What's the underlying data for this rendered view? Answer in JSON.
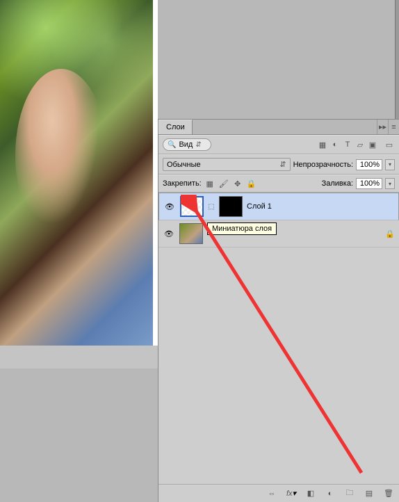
{
  "panel": {
    "title": "Слои",
    "search_label": "Вид",
    "blend_mode": "Обычные",
    "opacity_label": "Непрозрачность:",
    "opacity_value": "100%",
    "lock_label": "Закрепить:",
    "fill_label": "Заливка:",
    "fill_value": "100%"
  },
  "filter_icons": [
    "image-filter-icon",
    "adjust-filter-icon",
    "type-filter-icon",
    "shape-filter-icon",
    "smart-filter-icon"
  ],
  "lock_icons": [
    "lock-transparent-icon",
    "lock-paint-icon",
    "lock-move-icon",
    "lock-all-icon"
  ],
  "layers": [
    {
      "name": "Слой 1",
      "selected": true,
      "has_mask": true,
      "linked": true,
      "thumb": "checker"
    },
    {
      "name": "Фон",
      "selected": false,
      "locked": true,
      "thumb": "img"
    }
  ],
  "tooltip": "Миниатюра слоя",
  "footer_icons": [
    "link-icon",
    "fx-icon",
    "mask-icon",
    "adjustment-icon",
    "group-icon",
    "new-layer-icon",
    "delete-icon"
  ]
}
